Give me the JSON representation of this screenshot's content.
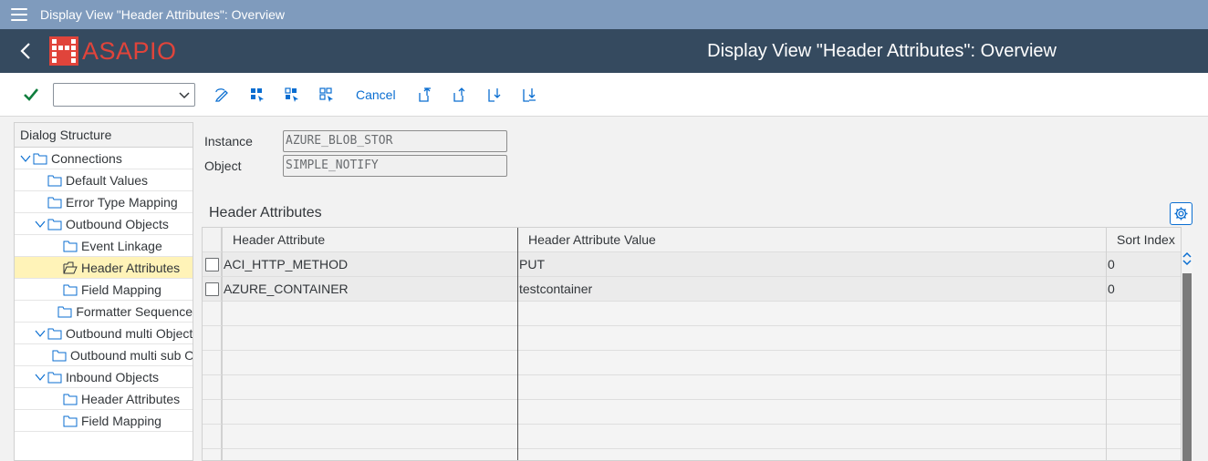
{
  "window": {
    "title": "Display View \"Header Attributes\": Overview"
  },
  "header": {
    "logo_text": "ASAPIO",
    "page_title": "Display View \"Header Attributes\": Overview"
  },
  "toolbar": {
    "select_value": "",
    "cancel_label": "Cancel"
  },
  "dialog_structure": {
    "title": "Dialog Structure",
    "items": [
      {
        "label": "Connections",
        "level": 0,
        "expanded": true
      },
      {
        "label": "Default Values",
        "level": 1
      },
      {
        "label": "Error Type Mapping",
        "level": 1
      },
      {
        "label": "Outbound  Objects",
        "level": 1,
        "expanded": true
      },
      {
        "label": "Event Linkage",
        "level": 2
      },
      {
        "label": "Header Attributes",
        "level": 2,
        "selected": true
      },
      {
        "label": "Field Mapping",
        "level": 2
      },
      {
        "label": "Formatter Sequence",
        "level": 2
      },
      {
        "label": "Outbound multi Objects",
        "level": 1,
        "expanded": true
      },
      {
        "label": "Outbound multi sub Objects",
        "level": 2
      },
      {
        "label": "Inbound Objects",
        "level": 1,
        "expanded": true
      },
      {
        "label": "Header Attributes",
        "level": 2
      },
      {
        "label": "Field Mapping",
        "level": 2
      }
    ]
  },
  "form": {
    "instance_label": "Instance",
    "instance_value": "AZURE_BLOB_STOR",
    "object_label": "Object",
    "object_value": "SIMPLE_NOTIFY"
  },
  "table": {
    "title": "Header Attributes",
    "columns": [
      "Header Attribute",
      "Header Attribute Value",
      "Sort Index"
    ],
    "rows": [
      [
        "ACI_HTTP_METHOD",
        "PUT",
        "0"
      ],
      [
        "AZURE_CONTAINER",
        "testcontainer",
        "0"
      ]
    ]
  },
  "colors": {
    "titlebar": "#7f9bbd",
    "header": "#354a5f",
    "brand": "#e0443b",
    "accent": "#0a6ed1",
    "selected_row": "#fff3b8",
    "confirm": "#107e3e"
  },
  "icons": {
    "menu": "hamburger-icon",
    "back": "back-arrow-icon",
    "confirm": "checkmark-icon",
    "toolbar": [
      "display-change-icon",
      "select-all-icon",
      "select-block-icon",
      "deselect-all-icon",
      "first-page-icon",
      "previous-page-icon",
      "next-page-icon",
      "last-page-icon"
    ],
    "settings": "settings-gear-icon"
  }
}
